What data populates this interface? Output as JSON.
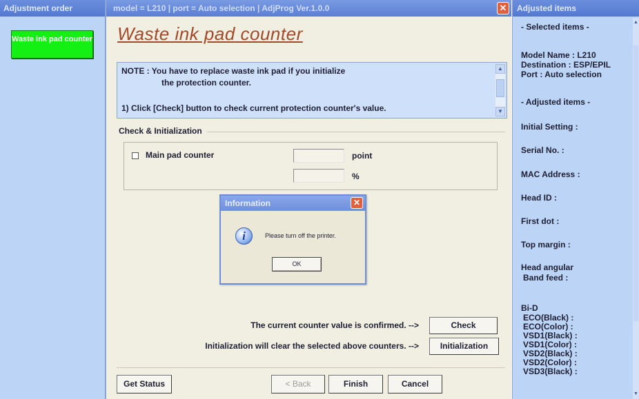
{
  "left_panel": {
    "title": "Adjustment order",
    "active_item": "Waste ink pad counter"
  },
  "main_window": {
    "title": "model = L210 | port = Auto selection | AdjProg Ver.1.0.0",
    "close_glyph": "✕",
    "page_title": "Waste ink pad counter",
    "note": {
      "line1": "NOTE : You have to replace waste ink pad if you initialize",
      "line2": "the protection counter.",
      "line3": "1) Click [Check] button to check current protection counter's value."
    },
    "group": {
      "legend": "Check & Initialization",
      "counter_label": "Main pad counter",
      "point_value": "",
      "percent_value": "",
      "unit_point": "point",
      "unit_percent": "%"
    },
    "actions": {
      "confirm_text": "The current counter value is confirmed. -->",
      "check_label": "Check",
      "init_text": "Initialization will clear the selected above counters. -->",
      "init_label": "Initialization"
    },
    "footer": {
      "get_status": "Get Status",
      "back": "< Back",
      "finish": "Finish",
      "cancel": "Cancel"
    }
  },
  "dialog": {
    "title": "Information",
    "close_glyph": "✕",
    "icon_glyph": "i",
    "message": "Please turn off the printer.",
    "ok_label": "OK"
  },
  "right_panel": {
    "title": "Adjusted items",
    "selected_header": "- Selected items -",
    "model_name": "Model Name : L210",
    "destination": "Destination : ESP/EPIL",
    "port": "Port : Auto selection",
    "adjusted_header": "- Adjusted items -",
    "initial_setting": "Initial Setting :",
    "serial_no": "Serial No. :",
    "mac_address": "MAC Address :",
    "head_id": "Head ID :",
    "first_dot": "First dot :",
    "top_margin": "Top margin :",
    "head_angular": "Head angular",
    "band_feed": "Band feed :",
    "bid": "Bi-D",
    "eco_black": "ECO(Black)  :",
    "eco_color": "ECO(Color)  :",
    "vsd1_black": "VSD1(Black) :",
    "vsd1_color": "VSD1(Color) :",
    "vsd2_black": "VSD2(Black) :",
    "vsd2_color": "VSD2(Color) :",
    "vsd3_black": "VSD3(Black) :"
  },
  "colors": {
    "title_bar": "#5a7fd3",
    "panel_bg": "#bcd4f6",
    "window_bg": "#f1eee2",
    "page_title": "#a14a2a",
    "active_item": "#14f014",
    "close_button": "#e45e3c"
  },
  "icons": {
    "window_close": "close-icon",
    "info": "information-icon",
    "scroll_up": "chevron-up-icon",
    "scroll_down": "chevron-down-icon"
  }
}
